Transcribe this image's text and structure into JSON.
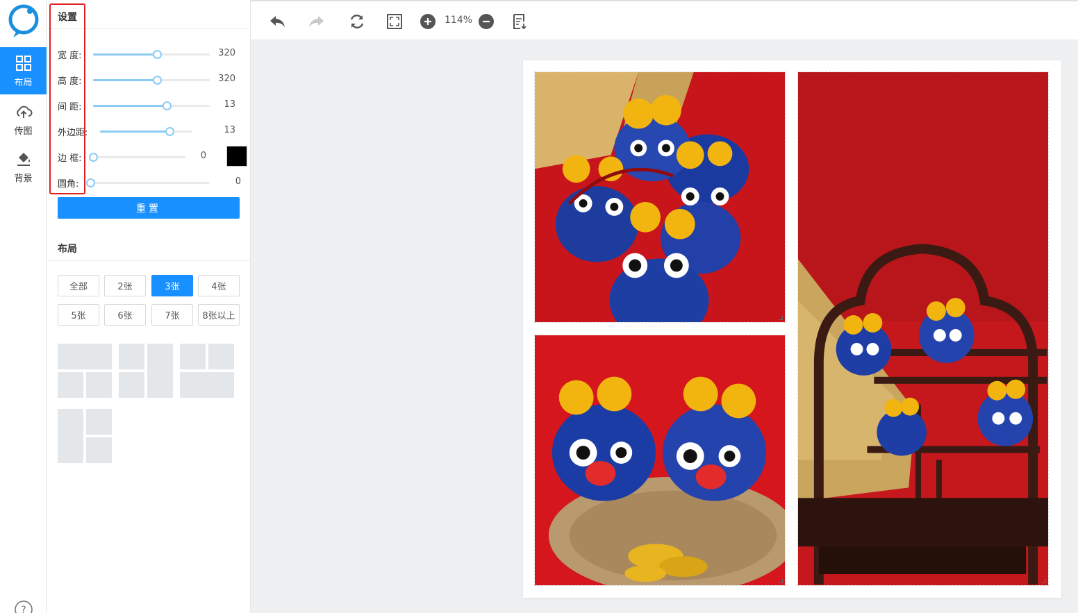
{
  "sidebar": {
    "items": [
      {
        "label": "布局",
        "icon": "grid-layout-icon",
        "active": true
      },
      {
        "label": "传图",
        "icon": "cloud-upload-icon",
        "active": false
      },
      {
        "label": "背景",
        "icon": "paint-bucket-icon",
        "active": false
      }
    ],
    "help_icon": "help-icon"
  },
  "settings": {
    "title": "设置",
    "width_label": "宽 度:",
    "width_value": "320",
    "width_level": 0.55,
    "height_label": "高 度:",
    "height_value": "320",
    "height_level": 0.55,
    "spacing_label": "间 距:",
    "spacing_value": "13",
    "spacing_level": 0.63,
    "margin_label": "外边距:",
    "margin_value": "13",
    "margin_level": 0.75,
    "border_label": "边 框:",
    "border_value": "0",
    "border_level": 0,
    "border_color": "#000000",
    "radius_label": "圆角:",
    "radius_value": "0",
    "radius_level": 0,
    "reset_label": "重置"
  },
  "layout": {
    "title": "布局",
    "filters": [
      {
        "label": "全部",
        "active": false
      },
      {
        "label": "2张",
        "active": false
      },
      {
        "label": "3张",
        "active": true
      },
      {
        "label": "4张",
        "active": false
      },
      {
        "label": "5张",
        "active": false
      },
      {
        "label": "6张",
        "active": false
      },
      {
        "label": "7张",
        "active": false
      },
      {
        "label": "8张以上",
        "active": false
      }
    ]
  },
  "toolbar": {
    "zoom": "114%",
    "icons": [
      "undo-icon",
      "redo-icon",
      "refresh-icon",
      "fit-screen-icon",
      "zoom-in-icon",
      "zoom-out-icon",
      "export-icon"
    ]
  },
  "colors": {
    "accent": "#1890ff",
    "highlight_box": "#e02020",
    "slider": "#8ccbf5"
  }
}
